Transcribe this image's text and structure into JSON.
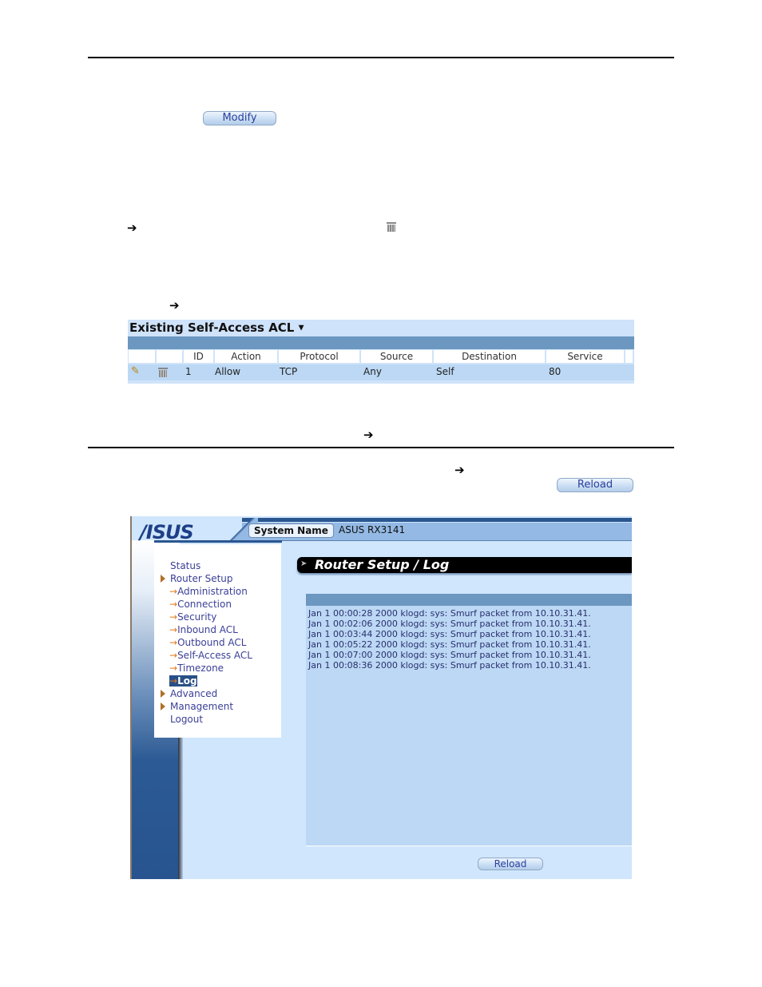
{
  "doc": {
    "modify_button": "Modify",
    "arrow_glyph": "➔",
    "reload_button_top": "Reload"
  },
  "acl": {
    "title": "Existing Self-Access ACL",
    "caret": "▼",
    "columns": [
      "",
      "",
      "ID",
      "Action",
      "Protocol",
      "Source",
      "Destination",
      "Service"
    ],
    "rows": [
      {
        "id": "1",
        "action": "Allow",
        "protocol": "TCP",
        "source": "Any",
        "destination": "Self",
        "service": "80"
      }
    ]
  },
  "asus": {
    "logo": "/ISUS",
    "system_name_label": "System Name",
    "system_name_value": "ASUS RX3141",
    "menu": {
      "status": "Status",
      "router_setup": "Router Setup",
      "sub_arrow": "→",
      "sub_items": [
        "Administration",
        "Connection",
        "Security",
        "Inbound ACL",
        "Outbound ACL",
        "Self-Access ACL",
        "Timezone",
        "Log"
      ],
      "active": "Log",
      "advanced": "Advanced",
      "management": "Management",
      "logout": "Logout"
    },
    "page_title": "Router Setup / Log",
    "log_lines": [
      "Jan 1 00:00:28 2000 klogd: sys: Smurf packet from 10.10.31.41.",
      "Jan 1 00:02:06 2000 klogd: sys: Smurf packet from 10.10.31.41.",
      "Jan 1 00:03:44 2000 klogd: sys: Smurf packet from 10.10.31.41.",
      "Jan 1 00:05:22 2000 klogd: sys: Smurf packet from 10.10.31.41.",
      "Jan 1 00:07:00 2000 klogd: sys: Smurf packet from 10.10.31.41.",
      "Jan 1 00:08:36 2000 klogd: sys: Smurf packet from 10.10.31.41."
    ],
    "reload_button": "Reload"
  }
}
